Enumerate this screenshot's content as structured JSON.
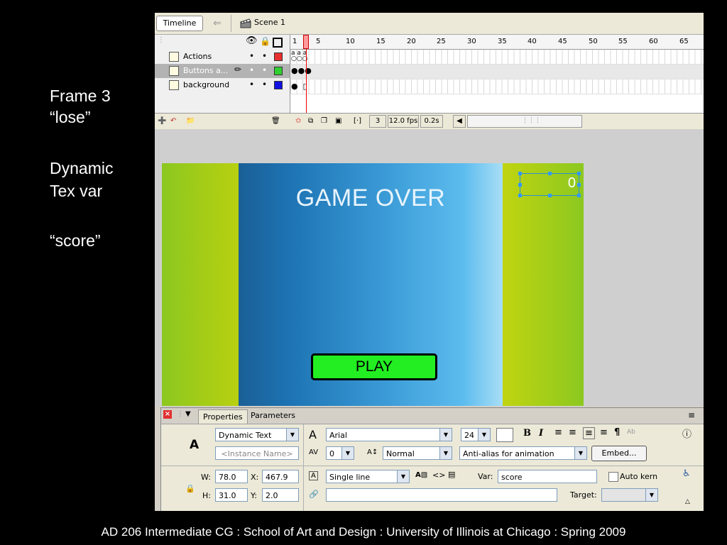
{
  "notes": {
    "line1": "Frame 3",
    "line2": "“lose”",
    "line3": "Dynamic",
    "line4": "Tex var",
    "line5": "“score”"
  },
  "footer": "AD 206 Intermediate CG  :  School of Art and Design :  University of Illinois at Chicago :  Spring 2009",
  "timeline": {
    "tab_label": "Timeline",
    "scene_label": "Scene 1",
    "ruler": [
      "1",
      "5",
      "10",
      "15",
      "20",
      "25",
      "30",
      "35",
      "40",
      "45",
      "50",
      "55",
      "60",
      "65"
    ],
    "layers": [
      {
        "name": "Actions",
        "color": "#e83030"
      },
      {
        "name": "Buttons a...",
        "color": "#30d030"
      },
      {
        "name": "background",
        "color": "#1010e0"
      }
    ],
    "status": {
      "frame": "3",
      "fps": "12.0 fps",
      "time": "0.2s"
    }
  },
  "stage": {
    "title": "GAME OVER",
    "play_label": "PLAY",
    "score_value": "0"
  },
  "properties": {
    "tab_properties": "Properties",
    "tab_parameters": "Parameters",
    "text_type": "Dynamic Text",
    "instance_placeholder": "<Instance Name>",
    "font": "Arial",
    "font_size": "24",
    "letter_spacing": "0",
    "position_mode": "Normal",
    "anti_alias": "Anti-alias for animation",
    "embed_label": "Embed...",
    "w_label": "W:",
    "w_value": "78.0",
    "x_label": "X:",
    "x_value": "467.9",
    "h_label": "H:",
    "h_value": "31.0",
    "y_label": "Y:",
    "y_value": "2.0",
    "line_type": "Single line",
    "var_label": "Var:",
    "var_value": "score",
    "auto_kern_label": "Auto kern",
    "target_label": "Target:"
  }
}
